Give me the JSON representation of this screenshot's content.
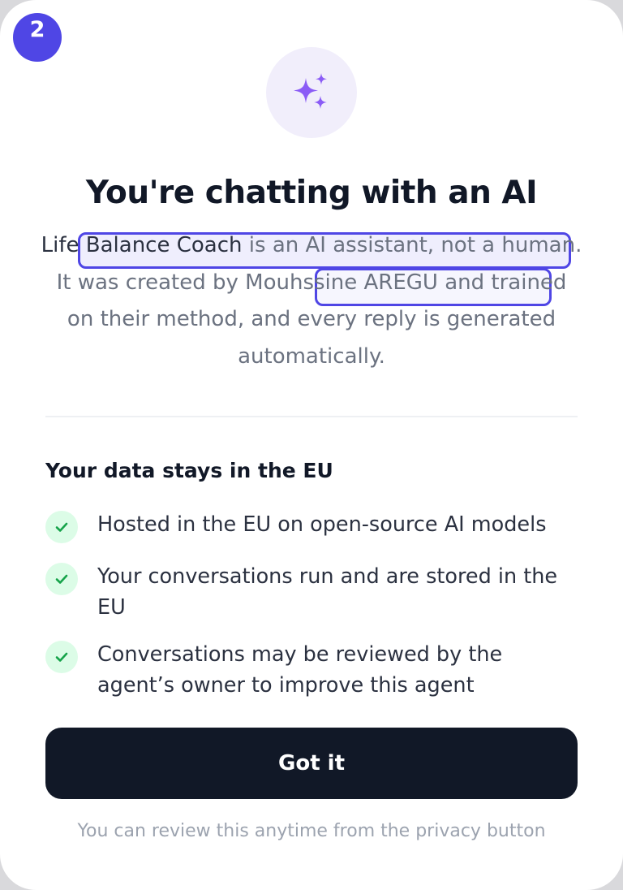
{
  "step": {
    "number": "2",
    "color": "#4f46e5"
  },
  "hero": {
    "icon": "sparkles-icon",
    "icon_color": "#8b5cf6",
    "background": "#f1eefb"
  },
  "title": "You're chatting with an AI",
  "intro": {
    "agent_name": "Life Balance Coach",
    "text_1": " is an AI assistant, not a human. It was created by ",
    "creator_name": "Mouhssine AREGU",
    "text_2": " and trained on their method, and every reply is generated automatically."
  },
  "data_section": {
    "heading": "Your data stays in the EU",
    "items": [
      {
        "icon": "check-icon",
        "text": "Hosted in the EU on open-source AI models"
      },
      {
        "icon": "check-icon",
        "text": "Your conversations run and are stored in the EU"
      },
      {
        "icon": "check-icon",
        "text": "Conversations may be reviewed by the agent’s owner to improve this agent"
      }
    ]
  },
  "primary_button": {
    "label": "Got it",
    "color": "#111827"
  },
  "footer_note": "You can review this anytime from the privacy button",
  "colors": {
    "accent": "#4f46e5",
    "check_bg": "#dcfce7",
    "check_fg": "#16a34a"
  }
}
